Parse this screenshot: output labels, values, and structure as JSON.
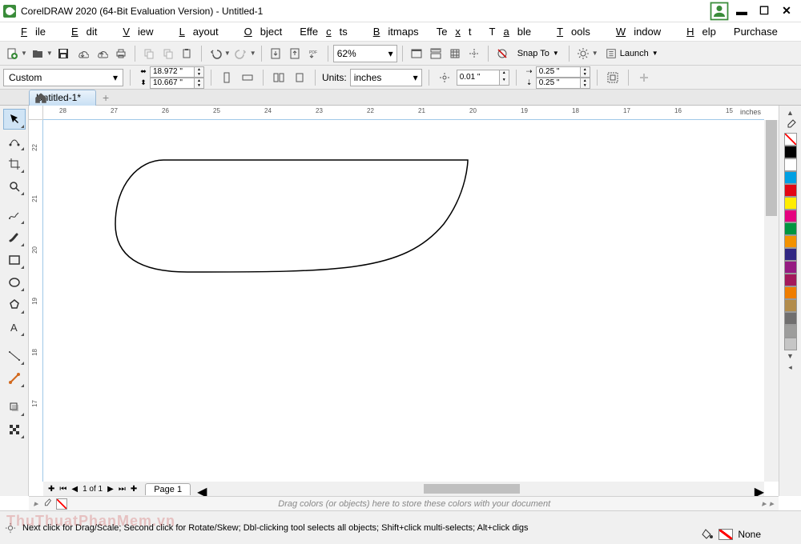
{
  "title": "CorelDRAW 2020 (64-Bit Evaluation Version) - Untitled-1",
  "menus": [
    "File",
    "Edit",
    "View",
    "Layout",
    "Object",
    "Effects",
    "Bitmaps",
    "Text",
    "Table",
    "Tools",
    "Window",
    "Help",
    "Purchase"
  ],
  "zoom": "62%",
  "snap_label": "Snap To",
  "launch_label": "Launch",
  "preset": "Custom",
  "page_w": "18.972 \"",
  "page_h": "10.667 \"",
  "units_label": "Units:",
  "units_value": "inches",
  "nudge": "0.01 \"",
  "dup_x": "0.25 \"",
  "dup_y": "0.25 \"",
  "doc_tab": "Untitled-1*",
  "ruler_h": [
    "28",
    "27",
    "26",
    "25",
    "24",
    "23",
    "22",
    "21",
    "20",
    "19",
    "18",
    "17",
    "16",
    "15"
  ],
  "ruler_h_unit": "inches",
  "ruler_v": [
    "22",
    "21",
    "20",
    "19",
    "18",
    "17"
  ],
  "page_nav": "1 of 1",
  "page_tab": "Page 1",
  "doc_pal_hint": "Drag colors (or objects) here to store these colors with your document",
  "status_hint": "Next click for Drag/Scale; Second click for Rotate/Skew; Dbl-clicking tool selects all objects; Shift+click multi-selects; Alt+click digs",
  "fill_label": "None",
  "watermark": "ThuThuatPhanMem.vn",
  "palette": [
    "#000000",
    "#ffffff",
    "#00a0e3",
    "#e30613",
    "#ffed00",
    "#e5007e",
    "#009640",
    "#f39200",
    "#312783",
    "#951b81",
    "#a3195b",
    "#ef7d00",
    "#b28c4b",
    "#706f6f",
    "#9d9d9c",
    "#c6c6c6"
  ]
}
